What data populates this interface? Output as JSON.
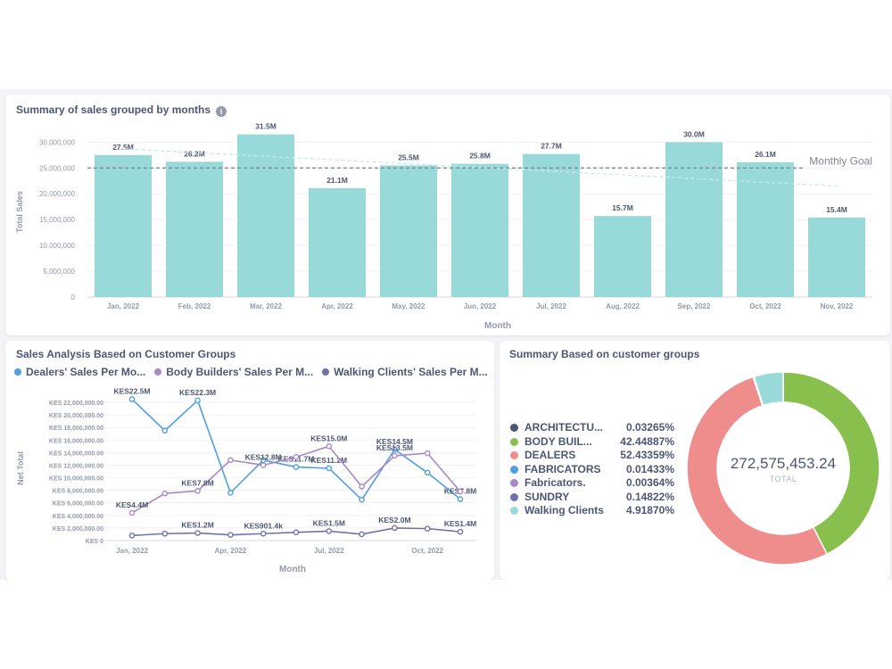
{
  "bar_card": {
    "title": "Summary of sales grouped by months",
    "info_icon": "info-icon"
  },
  "line_card": {
    "title": "Sales Analysis Based on Customer Groups"
  },
  "donut_card": {
    "title": "Summary Based on customer groups",
    "total": "272,575,453.24",
    "total_label": "TOTAL"
  },
  "chart_data": [
    {
      "type": "bar",
      "title": "Summary of sales grouped by months",
      "xlabel": "Month",
      "ylabel": "Total Sales",
      "categories": [
        "Jan, 2022",
        "Feb, 2022",
        "Mar, 2022",
        "Apr, 2022",
        "May, 2022",
        "Jun, 2022",
        "Jul, 2022",
        "Aug, 2022",
        "Sep, 2022",
        "Oct, 2022",
        "Nov, 2022"
      ],
      "values": [
        27500000,
        26200000,
        31500000,
        21100000,
        25500000,
        25800000,
        27700000,
        15700000,
        30000000,
        26100000,
        15400000
      ],
      "data_labels": [
        "27.5M",
        "26.2M",
        "31.5M",
        "21.1M",
        "25.5M",
        "25.8M",
        "27.7M",
        "15.7M",
        "30.0M",
        "26.1M",
        "15.4M"
      ],
      "y_ticks": [
        0,
        5000000,
        10000000,
        15000000,
        20000000,
        25000000,
        30000000
      ],
      "y_tick_labels": [
        "0",
        "5,000,000",
        "10,000,000",
        "15,000,000",
        "20,000,000",
        "25,000,000",
        "30,000,000"
      ],
      "ylim": [
        0,
        33000000
      ],
      "goal": {
        "label": "Monthly Goal",
        "value": 25000000
      },
      "trend": {
        "start": 28700000,
        "end": 21500000
      },
      "color": "#98d9d9",
      "grid": true
    },
    {
      "type": "line",
      "xlabel": "Month",
      "ylabel": "Net Total",
      "x": [
        "Jan, 2022",
        "Feb, 2022",
        "Mar, 2022",
        "Apr, 2022",
        "May, 2022",
        "Jun, 2022",
        "Jul, 2022",
        "Aug, 2022",
        "Sep, 2022",
        "Oct, 2022",
        "Nov, 2022"
      ],
      "x_tick_labels": [
        {
          "index": 0,
          "label": "Jan, 2022"
        },
        {
          "index": 3,
          "label": "Apr, 2022"
        },
        {
          "index": 6,
          "label": "Jul, 2022"
        },
        {
          "index": 9,
          "label": "Oct, 2022"
        }
      ],
      "y_ticks": [
        0,
        2000000,
        4000000,
        6000000,
        8000000,
        10000000,
        12000000,
        14000000,
        16000000,
        18000000,
        20000000,
        22000000
      ],
      "y_tick_labels": [
        "KES 0",
        "KES 2,000,000.00",
        "KES 4,000,000.00",
        "KES 6,000,000.00",
        "KES 8,000,000.00",
        "KES 10,000,000.00",
        "KES 12,000,000.00",
        "KES 14,000,000.00",
        "KES 16,000,000.00",
        "KES 18,000,000.00",
        "KES 20,000,000.00",
        "KES 22,000,000.00"
      ],
      "ylim": [
        0,
        23000000
      ],
      "series": [
        {
          "name": "Dealers' Sales Per Mo...",
          "color": "#509ee3",
          "values": [
            22500000,
            17500000,
            22300000,
            7600000,
            12800000,
            11700000,
            11500000,
            6500000,
            14500000,
            10800000,
            6600000
          ],
          "labels": [
            {
              "index": 0,
              "text": "KES22.5M"
            },
            {
              "index": 2,
              "text": "KES22.3M"
            },
            {
              "index": 5,
              "text": "KES11.7M"
            },
            {
              "index": 6,
              "text": "KES11.2M"
            },
            {
              "index": 8,
              "text": "KES14.5M"
            },
            {
              "index": 10,
              "text": "KES7.8M"
            }
          ]
        },
        {
          "name": "Body Builders' Sales Per M...",
          "color": "#a989c5",
          "values": [
            4400000,
            7500000,
            7900000,
            12800000,
            12000000,
            13300000,
            15000000,
            8600000,
            13500000,
            13900000,
            7800000
          ],
          "labels": [
            {
              "index": 0,
              "text": "KES4.4M"
            },
            {
              "index": 2,
              "text": "KES7.8M"
            },
            {
              "index": 4,
              "text": "KES12.8M"
            },
            {
              "index": 6,
              "text": "KES15.0M"
            },
            {
              "index": 8,
              "text": "KES13.5M"
            }
          ]
        },
        {
          "name": "Walking Clients' Sales Per M...",
          "color": "#7172ad",
          "values": [
            800000,
            1100000,
            1200000,
            900000,
            1100000,
            1300000,
            1500000,
            1000000,
            2000000,
            1900000,
            1400000
          ],
          "labels": [
            {
              "index": 2,
              "text": "KES1.2M"
            },
            {
              "index": 4,
              "text": "KES901.4k"
            },
            {
              "index": 6,
              "text": "KES1.5M"
            },
            {
              "index": 8,
              "text": "KES2.0M"
            },
            {
              "index": 10,
              "text": "KES1.4M"
            }
          ]
        }
      ],
      "legend": "top",
      "grid": true
    },
    {
      "type": "pie",
      "title": "Summary Based on customer groups",
      "slices": [
        {
          "name": "ARCHITECTU...",
          "percent_label": "0.03265%",
          "value": 0.03265,
          "color": "#4c5773"
        },
        {
          "name": "BODY BUIL...",
          "percent_label": "42.44887%",
          "value": 42.44887,
          "color": "#88bf4d"
        },
        {
          "name": "DEALERS",
          "percent_label": "52.43359%",
          "value": 52.43359,
          "color": "#ef8c8c"
        },
        {
          "name": "FABRICATORS",
          "percent_label": "0.01433%",
          "value": 0.01433,
          "color": "#509ee3"
        },
        {
          "name": "Fabricators.",
          "percent_label": "0.00364%",
          "value": 0.00364,
          "color": "#a989c5"
        },
        {
          "name": "SUNDRY",
          "percent_label": "0.14822%",
          "value": 0.14822,
          "color": "#7172ad"
        },
        {
          "name": "Walking Clients",
          "percent_label": "4.91870%",
          "value": 4.9187,
          "color": "#98d9d9"
        }
      ],
      "total": "272,575,453.24",
      "total_label": "TOTAL",
      "legend": "left"
    }
  ]
}
